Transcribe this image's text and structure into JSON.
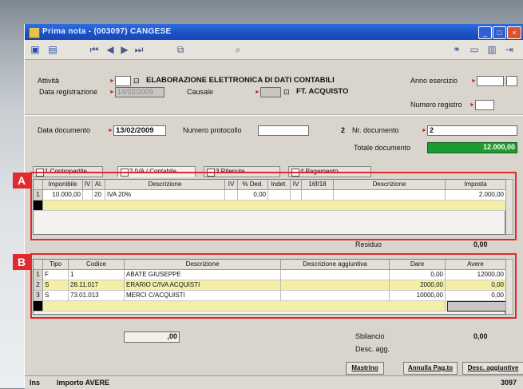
{
  "window": {
    "title": "Prima nota - (003097) CANGESE"
  },
  "header": {
    "attivita_label": "Attività",
    "company_name": "ELABORAZIONE ELETTRONICA DI DATI CONTABILI",
    "data_registrazione_label": "Data registrazione",
    "data_registrazione_value": "14/02/2009",
    "causale_label": "Causale",
    "causale_name": "FT. ACQUISTO",
    "anno_esercizio_label": "Anno esercizio",
    "numero_registro_label": "Numero registro",
    "data_documento_label": "Data documento",
    "data_documento_value": "13/02/2009",
    "numero_protocollo_label": "Numero protocollo",
    "protocol_count": "2",
    "nr_documento_label": "Nr. documento",
    "nr_documento_value": "2",
    "totale_documento_label": "Totale documento",
    "totale_documento_value": "12.000,00"
  },
  "tabs": [
    "1 Contropartite",
    "2 IVA / Contabile",
    "3 Ritenute",
    "4 Pagamento"
  ],
  "iva_grid": {
    "columns": [
      "Imponibile",
      "IV",
      "Al.",
      "Descrizione",
      "IV",
      "% Ded.",
      "Indet.",
      "IV",
      "16f/18",
      "Descrizione",
      "Imposta"
    ],
    "rows": [
      {
        "num": "1",
        "imponibile": "10.000,00",
        "aliquota": "20",
        "descrizione": "IVA 20%",
        "ded": "0,00",
        "imposta": "2.000,00"
      }
    ],
    "residuo_label": "Residuo",
    "residuo_value": "0,00"
  },
  "accounts_grid": {
    "columns": [
      "Tipo",
      "Codice",
      "Descrizione",
      "Descrizione aggiuntiva",
      "Dare",
      "Avere"
    ],
    "rows": [
      {
        "num": "1",
        "tipo": "F",
        "codice": "1",
        "descrizione": "ABATE GIUSEPPE",
        "dare": "0,00",
        "avere": "12000,00"
      },
      {
        "num": "2",
        "tipo": "S",
        "codice": "28.11.017",
        "descrizione": "ERARIO C/IVA ACQUISTI",
        "dare": "2000,00",
        "avere": "0,00"
      },
      {
        "num": "3",
        "tipo": "S",
        "codice": "73.01.013",
        "descrizione": "MERCI C/ACQUISTI",
        "dare": "10000,00",
        "avere": "0,00"
      }
    ]
  },
  "footer": {
    "total_value": ",00",
    "sbilancio_label": "Sbilancio",
    "sbilancio_value": "0,00",
    "desc_agg_label": "Desc. agg.",
    "btn_mastrino": "Mastrino",
    "btn_annulla": "Annulla Pag.to",
    "btn_desc_agg": "Desc. aggiuntive"
  },
  "statusbar": {
    "mode": "Ins",
    "message": "Importo AVERE",
    "code": "3097"
  },
  "annotations": {
    "a": "A",
    "b": "B"
  },
  "colors": {
    "highlight_total": "#1f9a2e",
    "annotation": "#e02a2f",
    "selected_row": "#f3efa6"
  }
}
